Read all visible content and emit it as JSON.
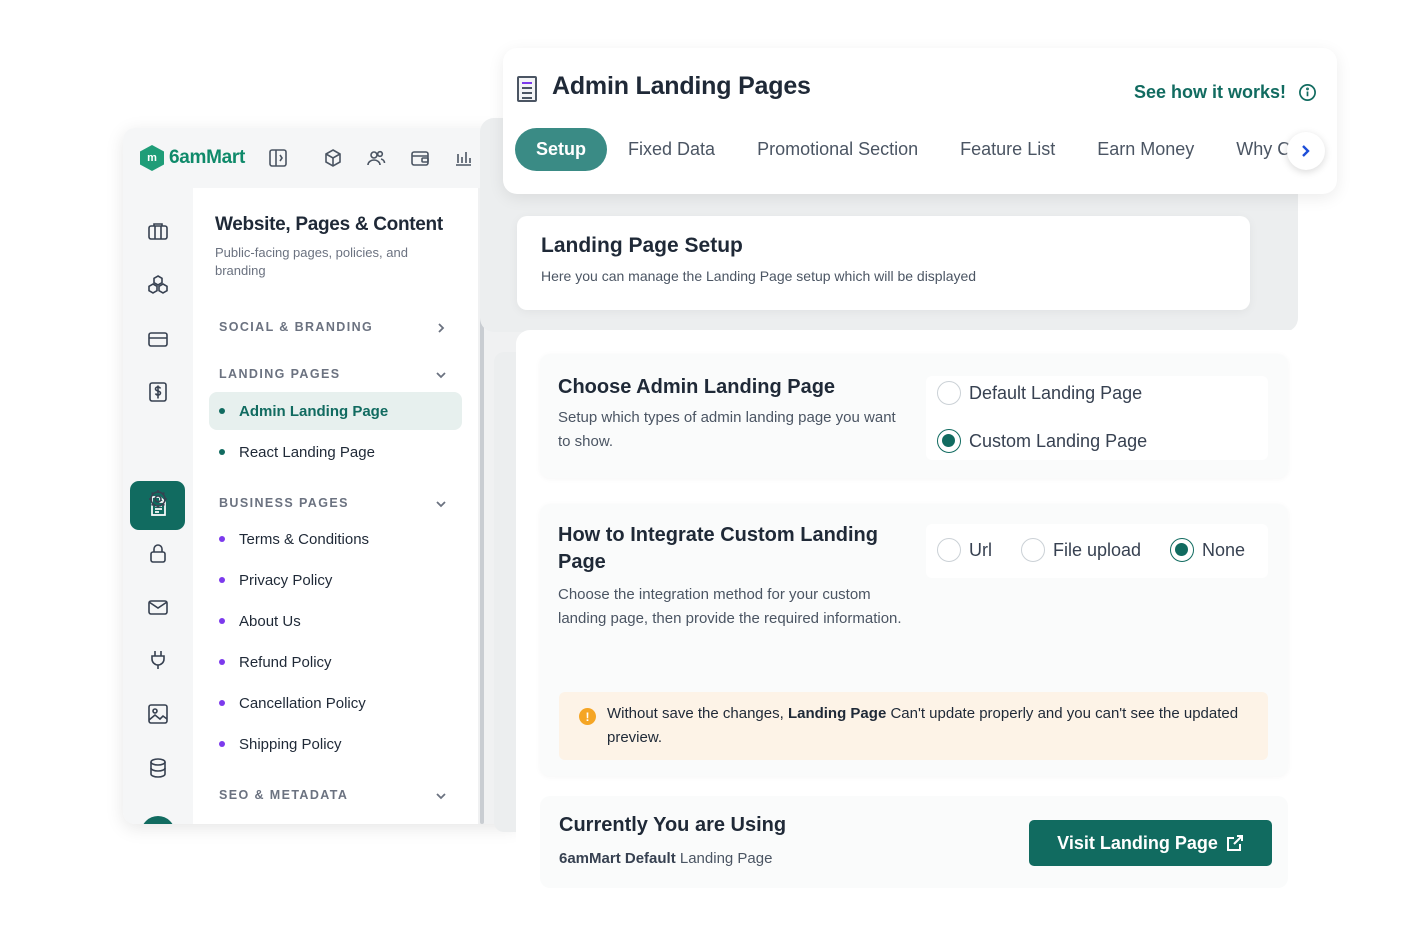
{
  "brand": {
    "logo_text": "6amMart",
    "logo_letter": "m"
  },
  "topbar_icons": [
    "sidebar-toggle-icon",
    "box-icon",
    "users-icon",
    "wallet-icon",
    "chart-icon",
    "more-icon"
  ],
  "rail_icons": [
    "briefcase-icon",
    "modules-icon",
    "card-icon",
    "dollar-file-icon",
    "document-icon",
    "settings-icon",
    "lock-icon",
    "mail-icon",
    "plug-icon",
    "image-icon",
    "database-icon"
  ],
  "menu": {
    "title": "Website, Pages & Content",
    "subtitle": "Public-facing pages, policies, and branding",
    "sections": {
      "social": "SOCIAL & BRANDING",
      "landing": "LANDING PAGES",
      "business": "BUSINESS PAGES",
      "seo": "SEO & METADATA"
    },
    "landing_items": [
      "Admin Landing Page",
      "React Landing Page"
    ],
    "business_items": [
      "Terms & Conditions",
      "Privacy Policy",
      "About Us",
      "Refund Policy",
      "Cancellation Policy",
      "Shipping Policy"
    ]
  },
  "header": {
    "title": "Admin Landing Pages",
    "see_how": "See how it works!",
    "tabs": [
      "Setup",
      "Fixed Data",
      "Promotional Section",
      "Feature List",
      "Earn Money",
      "Why C"
    ]
  },
  "setup": {
    "title": "Landing Page Setup",
    "subtitle": "Here you can manage the Landing Page setup which will be displayed"
  },
  "choose": {
    "title": "Choose Admin Landing Page",
    "desc": "Setup which types of admin landing page you want to show.",
    "options": [
      "Default Landing Page",
      "Custom Landing Page"
    ],
    "selected": "Custom Landing Page"
  },
  "integrate": {
    "title": "How to Integrate Custom Landing Page",
    "desc": "Choose the integration method for your custom landing page, then provide the required information.",
    "options": [
      "Url",
      "File upload",
      "None"
    ],
    "selected": "None"
  },
  "warning": {
    "icon": "!",
    "prefix": "Without save the changes, ",
    "bold": "Landing Page",
    "suffix": " Can't update properly and you can't see the updated preview."
  },
  "using": {
    "title": "Currently You are Using",
    "brand": "6amMart Default",
    "rest": " Landing Page",
    "button": "Visit Landing Page"
  },
  "colors": {
    "primary": "#116b60",
    "tab_active": "#3a8b85",
    "link": "#116b60",
    "warn_bg": "#fdf3e7",
    "dot_purple": "#7c3aed"
  }
}
